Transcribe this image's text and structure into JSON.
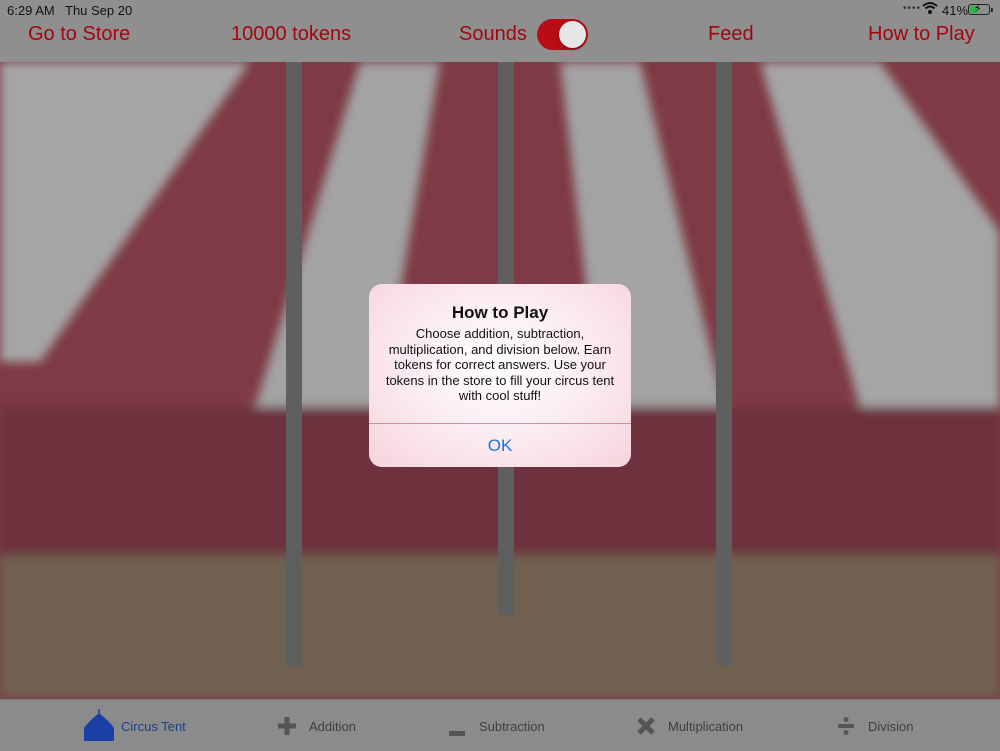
{
  "status_bar": {
    "time": "6:29 AM",
    "date": "Thu Sep 20",
    "signal": "••••",
    "battery_percent": "41%",
    "battery_level": 0.41
  },
  "nav": {
    "go_to_store": "Go to Store",
    "tokens": "10000 tokens",
    "sounds_label": "Sounds",
    "sounds_on": true,
    "feed": "Feed",
    "how_to_play": "How to Play"
  },
  "dialog": {
    "title": "How to Play",
    "message": "Choose addition, subtraction, multiplication, and division below. Earn tokens for correct answers. Use your tokens in the store to fill your circus tent with cool stuff!",
    "ok_label": "OK"
  },
  "tabs": [
    {
      "label": "Circus Tent",
      "icon": "circus-tent-icon",
      "active": true
    },
    {
      "label": "Addition",
      "icon": "plus-icon",
      "active": false
    },
    {
      "label": "Subtraction",
      "icon": "minus-icon",
      "active": false
    },
    {
      "label": "Multiplication",
      "icon": "multiply-icon",
      "active": false
    },
    {
      "label": "Division",
      "icon": "divide-icon",
      "active": false
    }
  ],
  "colors": {
    "accent_red": "#a3060f",
    "toggle_red": "#b80d16",
    "ok_blue": "#1e74e8",
    "active_tab_blue": "#1b3f8c"
  }
}
